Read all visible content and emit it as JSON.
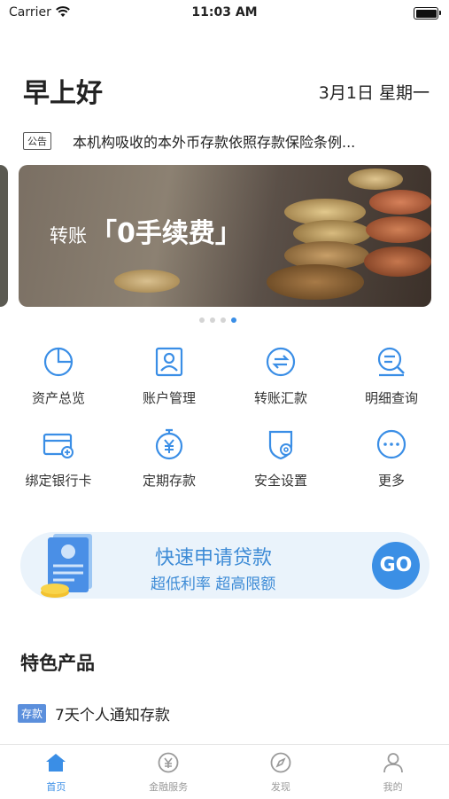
{
  "status_bar": {
    "carrier": "Carrier",
    "time": "11:03 AM"
  },
  "header": {
    "greeting": "早上好",
    "date": "3月1日 星期一"
  },
  "notice": {
    "tag": "公告",
    "text": "本机构吸收的本外币存款依照存款保险条例..."
  },
  "banner": {
    "text_prefix": "转账",
    "text_highlight": "「0手续费」",
    "page_count": 4,
    "active_page": 4
  },
  "quick_actions": [
    {
      "label": "资产总览",
      "icon": "pie-chart-icon"
    },
    {
      "label": "账户管理",
      "icon": "account-card-icon"
    },
    {
      "label": "转账汇款",
      "icon": "transfer-icon"
    },
    {
      "label": "明细查询",
      "icon": "search-detail-icon"
    },
    {
      "label": "绑定银行卡",
      "icon": "bank-card-icon"
    },
    {
      "label": "定期存款",
      "icon": "timer-yuan-icon"
    },
    {
      "label": "安全设置",
      "icon": "shield-gear-icon"
    },
    {
      "label": "更多",
      "icon": "more-icon"
    }
  ],
  "loan": {
    "title": "快速申请贷款",
    "subtitle": "超低利率 超高限额",
    "go": "GO"
  },
  "products": {
    "title": "特色产品",
    "items": [
      {
        "tag": "存款",
        "name": "7天个人通知存款"
      }
    ]
  },
  "tabbar": [
    {
      "label": "首页",
      "icon": "home-icon",
      "active": true
    },
    {
      "label": "金融服务",
      "icon": "yuan-coin-icon",
      "active": false
    },
    {
      "label": "发现",
      "icon": "compass-icon",
      "active": false
    },
    {
      "label": "我的",
      "icon": "person-icon",
      "active": false
    }
  ],
  "colors": {
    "accent": "#3a8ee6",
    "loan_bg": "#eaf3fb",
    "text": "#222222"
  }
}
